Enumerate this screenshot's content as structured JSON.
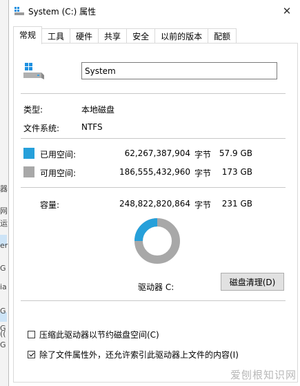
{
  "window": {
    "title": "System (C:) 属性",
    "close_glyph": "✕"
  },
  "tabs": [
    {
      "label": "常规"
    },
    {
      "label": "工具"
    },
    {
      "label": "硬件"
    },
    {
      "label": "共享"
    },
    {
      "label": "安全"
    },
    {
      "label": "以前的版本"
    },
    {
      "label": "配额"
    }
  ],
  "general": {
    "name_value": "System",
    "type_label": "类型:",
    "type_value": "本地磁盘",
    "fs_label": "文件系统:",
    "fs_value": "NTFS",
    "used": {
      "label": "已用空间:",
      "bytes": "62,267,387,904",
      "unit": "字节",
      "size": "57.9 GB",
      "color": "#26a0da"
    },
    "free": {
      "label": "可用空间:",
      "bytes": "186,555,432,960",
      "unit": "字节",
      "size": "173 GB",
      "color": "#a8a8a8"
    },
    "capacity": {
      "label": "容量:",
      "bytes": "248,822,820,864",
      "unit": "字节",
      "size": "231 GB"
    },
    "used_fraction": 0.25,
    "drive_label": "驱动器 C:",
    "cleanup_button": "磁盘清理(D)",
    "compress_option": {
      "label": "压缩此驱动器以节约磁盘空间(C)",
      "checked": false
    },
    "index_option": {
      "label": "除了文件属性外，还允许索引此驱动器上文件的内容(I)",
      "checked": true
    }
  },
  "background_window": {
    "fragments": [
      "器",
      "网",
      "运",
      "er",
      "G",
      "ia",
      "G",
      "G",
      "((",
      "G"
    ]
  },
  "watermark": "爱刨根知识网"
}
